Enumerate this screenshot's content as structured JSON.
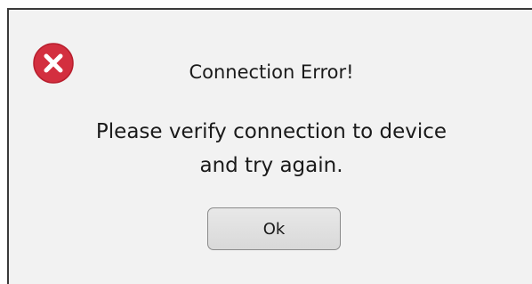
{
  "dialog": {
    "icon": "error-circle-x-icon",
    "title": "Connection Error!",
    "message_line1": "Please verify connection to device",
    "message_line2": "and try again.",
    "ok_label": "Ok"
  },
  "colors": {
    "icon_red": "#d32f3f",
    "background": "#f2f2f2"
  }
}
